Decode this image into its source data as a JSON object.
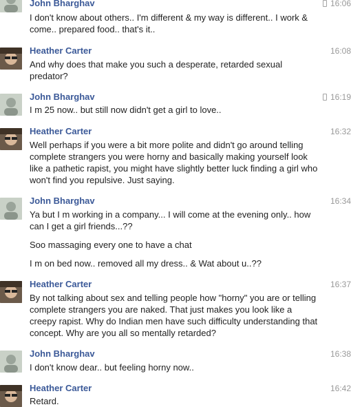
{
  "messages": [
    {
      "sender": "John Bharghav",
      "time": "16:06",
      "mobile": true,
      "lines": [
        "I don't know about others.. I'm different & my way is different.. I work &",
        "come.. prepared food.. that's it.."
      ]
    },
    {
      "sender": "Heather Carter",
      "time": "16:08",
      "mobile": false,
      "lines": [
        "And why does that make you such a desperate, retarded sexual",
        "predator?"
      ]
    },
    {
      "sender": "John Bharghav",
      "time": "16:19",
      "mobile": true,
      "lines": [
        "I m 25 now.. but still now didn't get a girl to love.."
      ]
    },
    {
      "sender": "Heather Carter",
      "time": "16:32",
      "mobile": false,
      "lines": [
        "Well perhaps if you were a bit more polite and didn't go around telling",
        "complete strangers you were horny and basically making yourself look",
        "like a pathetic rapist, you might have slightly better luck finding a girl who",
        "won't find you repulsive. Just saying."
      ]
    },
    {
      "sender": "John Bharghav",
      "time": "16:34",
      "mobile": false,
      "lines": [
        "Ya but I m working in a company... I will come at the evening only.. how",
        "can I get a girl friends...??",
        "Soo massaging every one to have a chat",
        "I m on bed now.. removed all my dress.. & Wat about u..??"
      ]
    },
    {
      "sender": "Heather Carter",
      "time": "16:37",
      "mobile": false,
      "lines": [
        "By not talking about sex and telling people how \"horny\" you are or telling",
        "complete strangers you are naked. That just makes you look like a",
        "creepy rapist. Why do Indian men have such difficulty understanding that",
        "concept. Why are you all so mentally retarded?"
      ]
    },
    {
      "sender": "John Bharghav",
      "time": "16:38",
      "mobile": false,
      "lines": [
        "I don't know dear.. but feeling horny now.."
      ]
    },
    {
      "sender": "Heather Carter",
      "time": "16:42",
      "mobile": false,
      "lines": [
        "Retard."
      ]
    }
  ]
}
